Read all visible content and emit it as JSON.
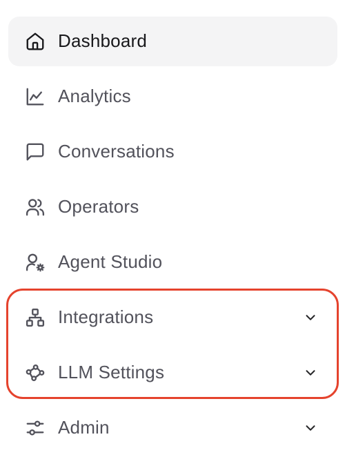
{
  "sidebar": {
    "items": [
      {
        "label": "Dashboard",
        "icon": "home-icon",
        "active": true
      },
      {
        "label": "Analytics",
        "icon": "line-chart-icon"
      },
      {
        "label": "Conversations",
        "icon": "message-square-icon"
      },
      {
        "label": "Operators",
        "icon": "users-icon"
      },
      {
        "label": "Agent Studio",
        "icon": "user-cog-icon"
      },
      {
        "label": "Integrations",
        "icon": "network-icon",
        "expandable": true
      },
      {
        "label": "LLM Settings",
        "icon": "workflow-icon",
        "expandable": true
      },
      {
        "label": "Admin",
        "icon": "sliders-icon",
        "expandable": true
      }
    ]
  },
  "highlight_color": "#e5432d"
}
